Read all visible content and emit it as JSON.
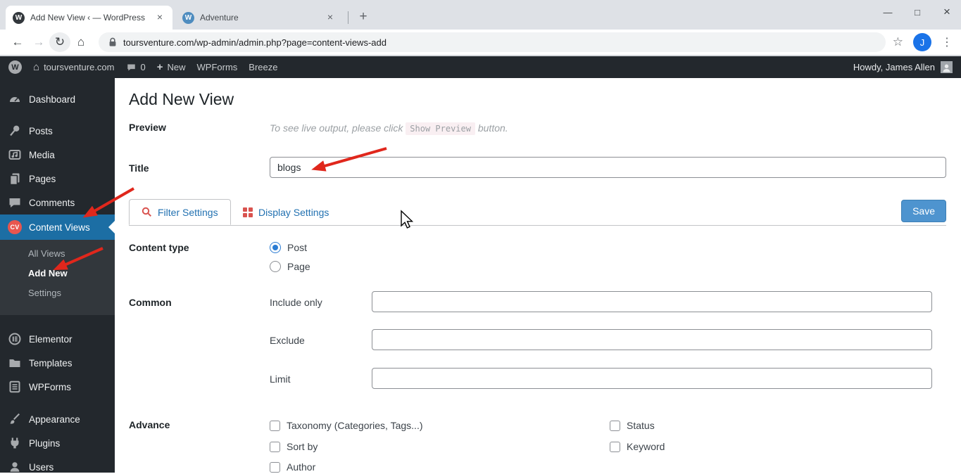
{
  "browser": {
    "tabs": [
      {
        "title": "Add New View ‹ — WordPress",
        "favicon_letter": "W"
      },
      {
        "title": "Adventure",
        "favicon_letter": "W"
      }
    ],
    "tab_close_icon": "×",
    "new_tab_icon": "+",
    "window_controls": {
      "minimize": "—",
      "maximize": "□",
      "close": "×"
    },
    "nav_icons": {
      "back": "←",
      "forward": "→",
      "reload": "↻",
      "home": "⌂"
    },
    "url": "toursventure.com/wp-admin/admin.php?page=content-views-add",
    "bookmark_icon": "☆",
    "profile_initial": "J",
    "menu_icon": "⋮"
  },
  "admin_bar": {
    "wp_logo_letter": "W",
    "home_icon": "⌂",
    "site_name": "toursventure.com",
    "comments_count": "0",
    "plus_icon": "+",
    "new_label": "New",
    "wpforms_label": "WPForms",
    "breeze_label": "Breeze",
    "howdy": "Howdy, James Allen"
  },
  "sidebar": {
    "items_top": [
      {
        "label": "Dashboard"
      },
      {
        "label": "Posts"
      },
      {
        "label": "Media"
      },
      {
        "label": "Pages"
      },
      {
        "label": "Comments"
      }
    ],
    "content_views": {
      "label": "Content Views",
      "badge": "CV"
    },
    "submenu": [
      {
        "label": "All Views"
      },
      {
        "label": "Add New",
        "active": true
      },
      {
        "label": "Settings"
      }
    ],
    "items_plugins": [
      {
        "label": "Elementor"
      },
      {
        "label": "Templates"
      },
      {
        "label": "WPForms"
      }
    ],
    "items_bottom": [
      {
        "label": "Appearance"
      },
      {
        "label": "Plugins"
      },
      {
        "label": "Users"
      }
    ]
  },
  "main": {
    "page_title": "Add New View",
    "preview": {
      "label": "Preview",
      "text_before": "To see live output, please click",
      "code": "Show Preview",
      "text_after": "button."
    },
    "title_field": {
      "label": "Title",
      "value": "blogs"
    },
    "tabs": [
      {
        "label": "Filter Settings",
        "active": true
      },
      {
        "label": "Display Settings",
        "active": false
      }
    ],
    "save_label": "Save",
    "content_type": {
      "label": "Content type",
      "options": [
        {
          "label": "Post",
          "selected": true
        },
        {
          "label": "Page",
          "selected": false
        }
      ]
    },
    "common": {
      "label": "Common",
      "fields": [
        {
          "label": "Include only",
          "value": ""
        },
        {
          "label": "Exclude",
          "value": ""
        },
        {
          "label": "Limit",
          "value": ""
        }
      ]
    },
    "advance": {
      "label": "Advance",
      "column1": [
        {
          "label": "Taxonomy (Categories, Tags...)",
          "checked": false
        },
        {
          "label": "Sort by",
          "checked": false
        },
        {
          "label": "Author",
          "checked": false
        }
      ],
      "column2": [
        {
          "label": "Status",
          "checked": false
        },
        {
          "label": "Keyword",
          "checked": false
        }
      ]
    }
  },
  "colors": {
    "active_menu_bg": "#1c6ea4",
    "cv_badge": "#e8564f",
    "tab_link_text": "#2271b1",
    "tab_icon_red": "#d9534f",
    "save_button_bg": "#4e94cf",
    "annotation_arrow": "#e0271c",
    "profile_avatar_bg": "#1a73e8"
  }
}
